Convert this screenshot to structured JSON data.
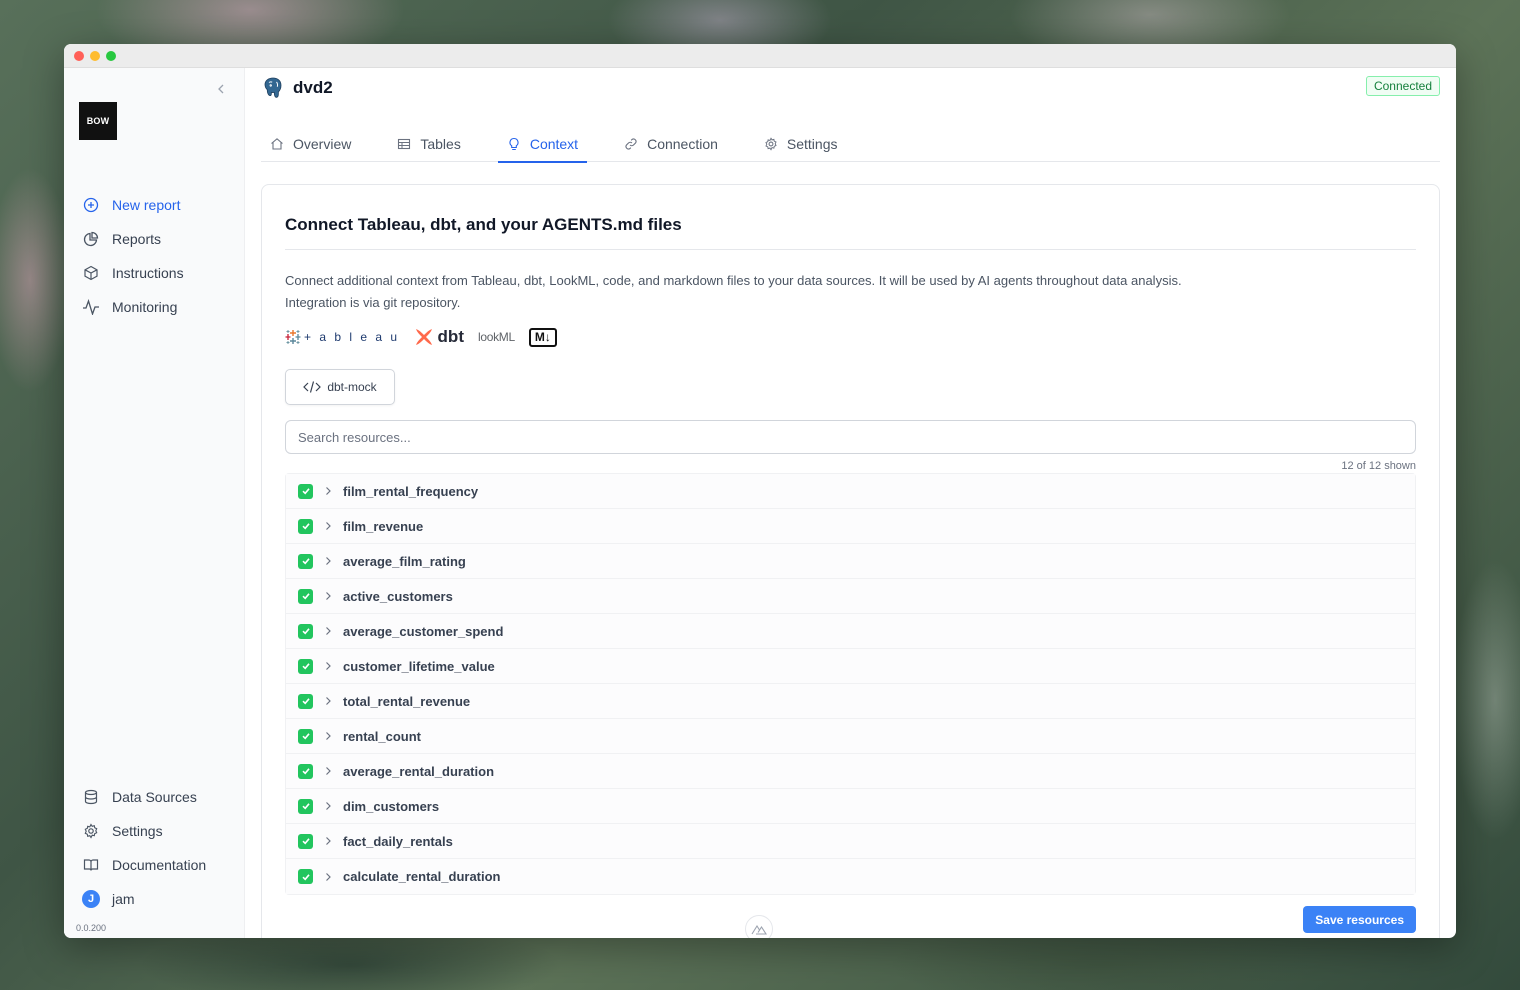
{
  "sidebar": {
    "logo_text": "BOW",
    "collapse_icon": "chevron-left-icon",
    "nav": [
      {
        "label": "New report",
        "icon": "plus-circle-icon"
      },
      {
        "label": "Reports",
        "icon": "pie-chart-icon"
      },
      {
        "label": "Instructions",
        "icon": "cube-icon"
      },
      {
        "label": "Monitoring",
        "icon": "activity-icon"
      }
    ],
    "bottom_nav": [
      {
        "label": "Data Sources",
        "icon": "database-icon"
      },
      {
        "label": "Settings",
        "icon": "gear-icon"
      },
      {
        "label": "Documentation",
        "icon": "book-icon"
      }
    ],
    "user": {
      "initial": "J",
      "name": "jam"
    },
    "version": "0.0.200"
  },
  "header": {
    "datasource_name": "dvd2",
    "datasource_icon": "postgres-elephant-icon",
    "status": "Connected",
    "status_color": "#15803d"
  },
  "tabs": [
    {
      "label": "Overview",
      "icon": "home-icon",
      "active": false
    },
    {
      "label": "Tables",
      "icon": "table-icon",
      "active": false
    },
    {
      "label": "Context",
      "icon": "lightbulb-icon",
      "active": true
    },
    {
      "label": "Connection",
      "icon": "link-icon",
      "active": false
    },
    {
      "label": "Settings",
      "icon": "gear-icon",
      "active": false
    }
  ],
  "context": {
    "title": "Connect Tableau, dbt, and your AGENTS.md files",
    "description_line1": "Connect additional context from Tableau, dbt, LookML, code, and markdown files to your data sources. It will be used by AI agents throughout data analysis.",
    "description_line2": "Integration is via git repository.",
    "brands": {
      "tableau": "+ a b l e a u",
      "dbt": "dbt",
      "lookml": "lookML",
      "markdown": "M↓"
    },
    "repo_label": "dbt-mock",
    "search_placeholder": "Search resources...",
    "shown_count": "12 of 12 shown",
    "resources": [
      "film_rental_frequency",
      "film_revenue",
      "average_film_rating",
      "active_customers",
      "average_customer_spend",
      "customer_lifetime_value",
      "total_rental_revenue",
      "rental_count",
      "average_rental_duration",
      "dim_customers",
      "fact_daily_rentals",
      "calculate_rental_duration"
    ],
    "save_label": "Save resources"
  },
  "colors": {
    "accent": "#2563eb",
    "checkbox": "#22c55e",
    "save_button": "#3b82f6"
  }
}
